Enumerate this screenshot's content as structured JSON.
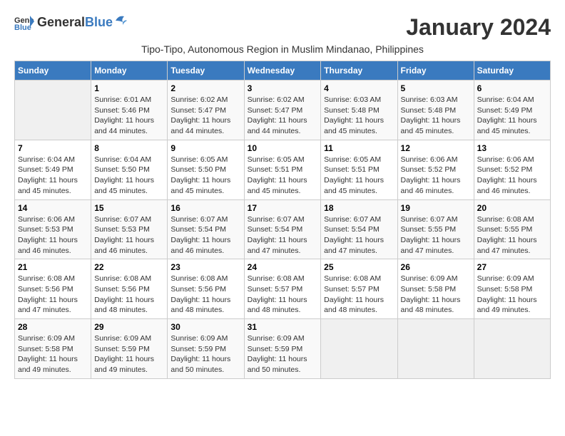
{
  "header": {
    "logo_general": "General",
    "logo_blue": "Blue",
    "month_title": "January 2024",
    "subtitle": "Tipo-Tipo, Autonomous Region in Muslim Mindanao, Philippines"
  },
  "calendar": {
    "days_of_week": [
      "Sunday",
      "Monday",
      "Tuesday",
      "Wednesday",
      "Thursday",
      "Friday",
      "Saturday"
    ],
    "weeks": [
      [
        {
          "day": "",
          "info": ""
        },
        {
          "day": "1",
          "info": "Sunrise: 6:01 AM\nSunset: 5:46 PM\nDaylight: 11 hours and 44 minutes."
        },
        {
          "day": "2",
          "info": "Sunrise: 6:02 AM\nSunset: 5:47 PM\nDaylight: 11 hours and 44 minutes."
        },
        {
          "day": "3",
          "info": "Sunrise: 6:02 AM\nSunset: 5:47 PM\nDaylight: 11 hours and 44 minutes."
        },
        {
          "day": "4",
          "info": "Sunrise: 6:03 AM\nSunset: 5:48 PM\nDaylight: 11 hours and 45 minutes."
        },
        {
          "day": "5",
          "info": "Sunrise: 6:03 AM\nSunset: 5:48 PM\nDaylight: 11 hours and 45 minutes."
        },
        {
          "day": "6",
          "info": "Sunrise: 6:04 AM\nSunset: 5:49 PM\nDaylight: 11 hours and 45 minutes."
        }
      ],
      [
        {
          "day": "7",
          "info": "Sunrise: 6:04 AM\nSunset: 5:49 PM\nDaylight: 11 hours and 45 minutes."
        },
        {
          "day": "8",
          "info": "Sunrise: 6:04 AM\nSunset: 5:50 PM\nDaylight: 11 hours and 45 minutes."
        },
        {
          "day": "9",
          "info": "Sunrise: 6:05 AM\nSunset: 5:50 PM\nDaylight: 11 hours and 45 minutes."
        },
        {
          "day": "10",
          "info": "Sunrise: 6:05 AM\nSunset: 5:51 PM\nDaylight: 11 hours and 45 minutes."
        },
        {
          "day": "11",
          "info": "Sunrise: 6:05 AM\nSunset: 5:51 PM\nDaylight: 11 hours and 45 minutes."
        },
        {
          "day": "12",
          "info": "Sunrise: 6:06 AM\nSunset: 5:52 PM\nDaylight: 11 hours and 46 minutes."
        },
        {
          "day": "13",
          "info": "Sunrise: 6:06 AM\nSunset: 5:52 PM\nDaylight: 11 hours and 46 minutes."
        }
      ],
      [
        {
          "day": "14",
          "info": "Sunrise: 6:06 AM\nSunset: 5:53 PM\nDaylight: 11 hours and 46 minutes."
        },
        {
          "day": "15",
          "info": "Sunrise: 6:07 AM\nSunset: 5:53 PM\nDaylight: 11 hours and 46 minutes."
        },
        {
          "day": "16",
          "info": "Sunrise: 6:07 AM\nSunset: 5:54 PM\nDaylight: 11 hours and 46 minutes."
        },
        {
          "day": "17",
          "info": "Sunrise: 6:07 AM\nSunset: 5:54 PM\nDaylight: 11 hours and 47 minutes."
        },
        {
          "day": "18",
          "info": "Sunrise: 6:07 AM\nSunset: 5:54 PM\nDaylight: 11 hours and 47 minutes."
        },
        {
          "day": "19",
          "info": "Sunrise: 6:07 AM\nSunset: 5:55 PM\nDaylight: 11 hours and 47 minutes."
        },
        {
          "day": "20",
          "info": "Sunrise: 6:08 AM\nSunset: 5:55 PM\nDaylight: 11 hours and 47 minutes."
        }
      ],
      [
        {
          "day": "21",
          "info": "Sunrise: 6:08 AM\nSunset: 5:56 PM\nDaylight: 11 hours and 47 minutes."
        },
        {
          "day": "22",
          "info": "Sunrise: 6:08 AM\nSunset: 5:56 PM\nDaylight: 11 hours and 48 minutes."
        },
        {
          "day": "23",
          "info": "Sunrise: 6:08 AM\nSunset: 5:56 PM\nDaylight: 11 hours and 48 minutes."
        },
        {
          "day": "24",
          "info": "Sunrise: 6:08 AM\nSunset: 5:57 PM\nDaylight: 11 hours and 48 minutes."
        },
        {
          "day": "25",
          "info": "Sunrise: 6:08 AM\nSunset: 5:57 PM\nDaylight: 11 hours and 48 minutes."
        },
        {
          "day": "26",
          "info": "Sunrise: 6:09 AM\nSunset: 5:58 PM\nDaylight: 11 hours and 48 minutes."
        },
        {
          "day": "27",
          "info": "Sunrise: 6:09 AM\nSunset: 5:58 PM\nDaylight: 11 hours and 49 minutes."
        }
      ],
      [
        {
          "day": "28",
          "info": "Sunrise: 6:09 AM\nSunset: 5:58 PM\nDaylight: 11 hours and 49 minutes."
        },
        {
          "day": "29",
          "info": "Sunrise: 6:09 AM\nSunset: 5:59 PM\nDaylight: 11 hours and 49 minutes."
        },
        {
          "day": "30",
          "info": "Sunrise: 6:09 AM\nSunset: 5:59 PM\nDaylight: 11 hours and 50 minutes."
        },
        {
          "day": "31",
          "info": "Sunrise: 6:09 AM\nSunset: 5:59 PM\nDaylight: 11 hours and 50 minutes."
        },
        {
          "day": "",
          "info": ""
        },
        {
          "day": "",
          "info": ""
        },
        {
          "day": "",
          "info": ""
        }
      ]
    ]
  }
}
